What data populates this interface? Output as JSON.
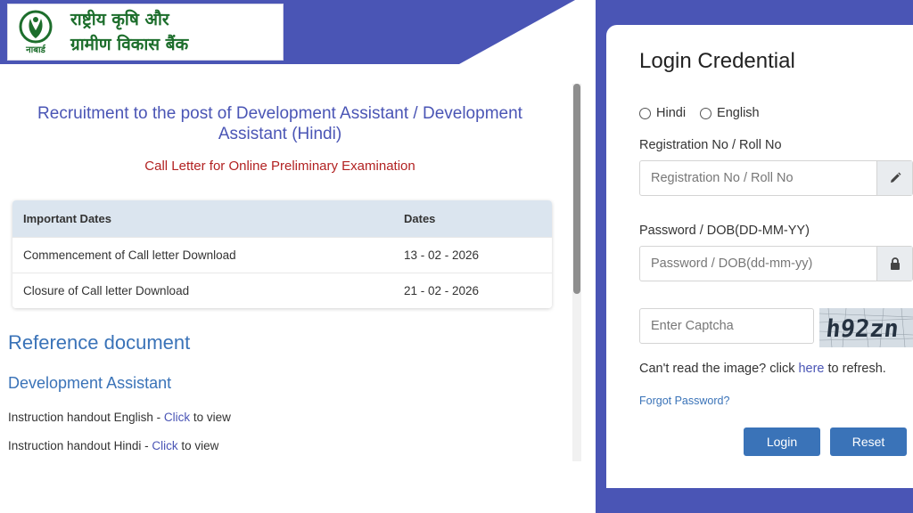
{
  "header": {
    "emblem_label": "नाबार्ड",
    "bank_name_line1": "राष्ट्रीय कृषि और",
    "bank_name_line2": "ग्रामीण विकास बैंक"
  },
  "content": {
    "post_title": "Recruitment to the post of Development Assistant / Development Assistant (Hindi)",
    "sub_title": "Call Letter for Online Preliminary Examination",
    "table": {
      "headers": [
        "Important Dates",
        "Dates"
      ],
      "rows": [
        [
          "Commencement of Call letter Download",
          "13 - 02 - 2026"
        ],
        [
          "Closure of Call letter Download",
          "21 - 02 - 2026"
        ]
      ]
    },
    "reference_heading": "Reference document",
    "section_heading": "Development Assistant",
    "handouts": [
      {
        "prefix": "Instruction handout English - ",
        "link": "Click",
        "suffix": " to view"
      },
      {
        "prefix": "Instruction handout Hindi - ",
        "link": "Click",
        "suffix": " to view"
      }
    ]
  },
  "login": {
    "title": "Login Credential",
    "languages": [
      "Hindi",
      "English"
    ],
    "registration_label": "Registration No / Roll No",
    "registration_placeholder": "Registration No / Roll No",
    "password_label": "Password / DOB(DD-MM-YY)",
    "password_placeholder": "Password / DOB(dd-mm-yy)",
    "captcha_placeholder": "Enter Captcha",
    "captcha_text": "h92zn",
    "refresh_prefix": "Can't read the image? click ",
    "refresh_link": "here",
    "refresh_suffix": " to refresh.",
    "forgot_password": "Forgot Password?",
    "login_button": "Login",
    "reset_button": "Reset"
  },
  "colors": {
    "band": "#4a55b5",
    "accent_blue": "#3a73b8",
    "title_purple": "#4a55b5",
    "subtitle_red": "#b22222",
    "brand_green": "#1d6e2c",
    "table_header": "#dbe5ef"
  }
}
